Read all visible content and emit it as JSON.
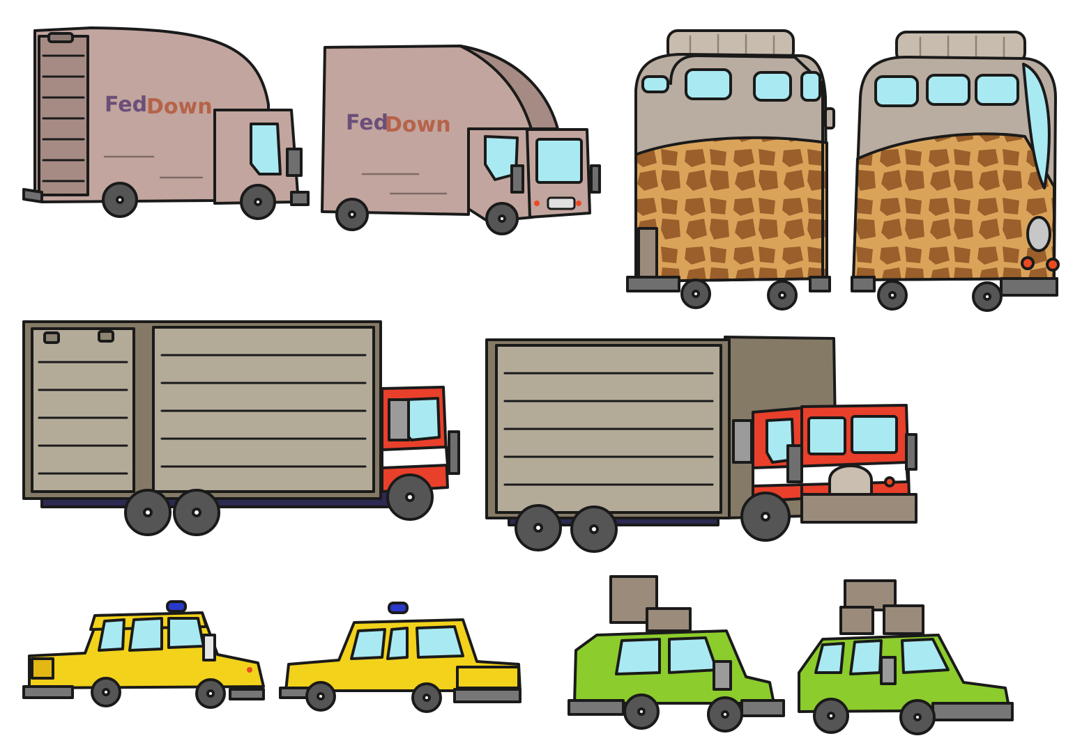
{
  "sheet": {
    "background": "#ffffff",
    "outline": "#1a1a1a"
  },
  "vehicles": [
    {
      "name": "delivery-van-side",
      "icon": "delivery-van-icon",
      "logo": {
        "part1": "Fed",
        "part2": "Down"
      }
    },
    {
      "name": "delivery-van-angled",
      "icon": "delivery-van-icon",
      "logo": {
        "part1": "Fed",
        "part2": "Down"
      }
    },
    {
      "name": "giraffe-bus-side",
      "icon": "bus-icon"
    },
    {
      "name": "giraffe-bus-angled",
      "icon": "bus-icon"
    },
    {
      "name": "box-truck-side",
      "icon": "truck-icon"
    },
    {
      "name": "box-truck-angled",
      "icon": "truck-icon"
    },
    {
      "name": "taxi-side",
      "icon": "taxi-icon"
    },
    {
      "name": "taxi-angled",
      "icon": "taxi-icon"
    },
    {
      "name": "green-car-side",
      "icon": "car-icon"
    },
    {
      "name": "green-car-angled",
      "icon": "car-icon"
    }
  ],
  "colors": {
    "van_body": "#c2a59e",
    "van_shade": "#a68b84",
    "logo_fed": "#6b4f79",
    "logo_down": "#b5634a",
    "window": "#a9e9f2",
    "bus_roof": "#b9aca0",
    "giraffe_base": "#d9a45a",
    "giraffe_spot": "#9a5f2b",
    "truck_box": "#b3aa98",
    "truck_frame": "#857a66",
    "truck_cab": "#e8402b",
    "truck_chassis": "#2c2a52",
    "taxi": "#f2d21b",
    "taxi_light": "#2a39c8",
    "car": "#8ccc2c",
    "luggage": "#9b8b7b",
    "bumper": "#777777",
    "tire": "#555555"
  }
}
